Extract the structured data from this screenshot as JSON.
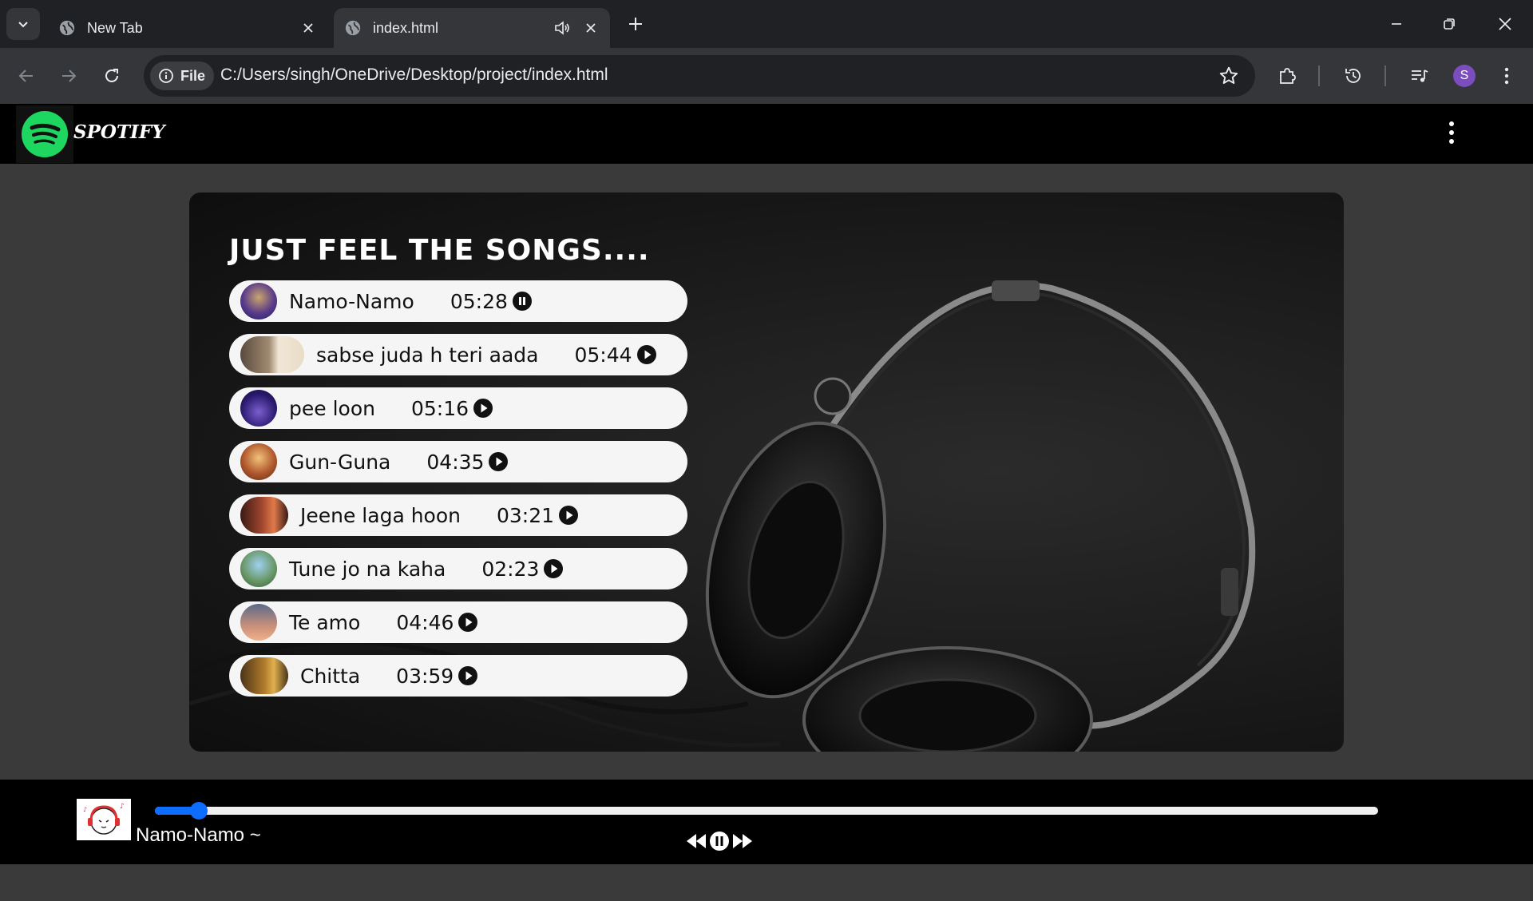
{
  "browser": {
    "tabs": [
      {
        "title": "New Tab",
        "active": false
      },
      {
        "title": "index.html",
        "active": true,
        "audible": true
      }
    ],
    "url_scheme_chip": "File",
    "url": "C:/Users/singh/OneDrive/Desktop/project/index.html",
    "profile_initial": "S"
  },
  "app": {
    "brand": "SPOTIFY",
    "heading": "JUST FEEL THE SONGS....",
    "accent_color": "#1ed760",
    "songs": [
      {
        "name": "Namo-Namo",
        "duration": "05:28",
        "state": "pause"
      },
      {
        "name": "sabse juda h teri aada",
        "duration": "05:44",
        "state": "play"
      },
      {
        "name": "pee loon",
        "duration": "05:16",
        "state": "play"
      },
      {
        "name": "Gun-Guna",
        "duration": "04:35",
        "state": "play"
      },
      {
        "name": "Jeene laga hoon",
        "duration": "03:21",
        "state": "play"
      },
      {
        "name": "Tune jo na kaha",
        "duration": "02:23",
        "state": "play"
      },
      {
        "name": "Te amo",
        "duration": "04:46",
        "state": "play"
      },
      {
        "name": "Chitta",
        "duration": "03:59",
        "state": "play"
      }
    ]
  },
  "player": {
    "current_song": "Namo-Namo ~",
    "progress_percent": 3.6,
    "progress_color": "#0d6efd"
  }
}
